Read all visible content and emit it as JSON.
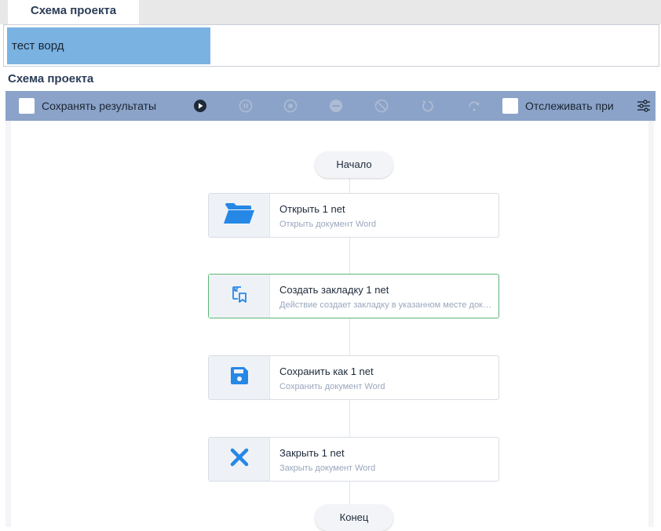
{
  "tab": {
    "label": "Схема проекта"
  },
  "name_field": {
    "value": "тест ворд"
  },
  "section": {
    "title": "Схема проекта"
  },
  "toolbar": {
    "save_results_label": "Сохранять результаты",
    "track_label": "Отслеживать при",
    "icons": [
      "play-icon",
      "pause-icon",
      "stop-icon",
      "minus-circle-icon",
      "disable-icon",
      "undo-icon",
      "redo-icon",
      "settings-sliders-icon"
    ]
  },
  "flow": {
    "start_label": "Начало",
    "end_label": "Конец",
    "nodes": [
      {
        "title": "Открыть  1  net",
        "desc": "Открыть документ Word",
        "icon": "folder-open-icon"
      },
      {
        "title": "Создать закладку  1  net",
        "desc": "Действие создает закладку в указанном месте документа",
        "icon": "bookmark-add-icon"
      },
      {
        "title": "Сохранить как  1  net",
        "desc": "Сохранить документ Word",
        "icon": "save-icon"
      },
      {
        "title": "Закрыть  1  net",
        "desc": "Закрыть документ Word",
        "icon": "close-icon"
      }
    ]
  },
  "colors": {
    "accent": "#2688e6",
    "toolbar": "#8ba3c8",
    "selection": "#7ab2e2",
    "active_border": "#5db774"
  }
}
